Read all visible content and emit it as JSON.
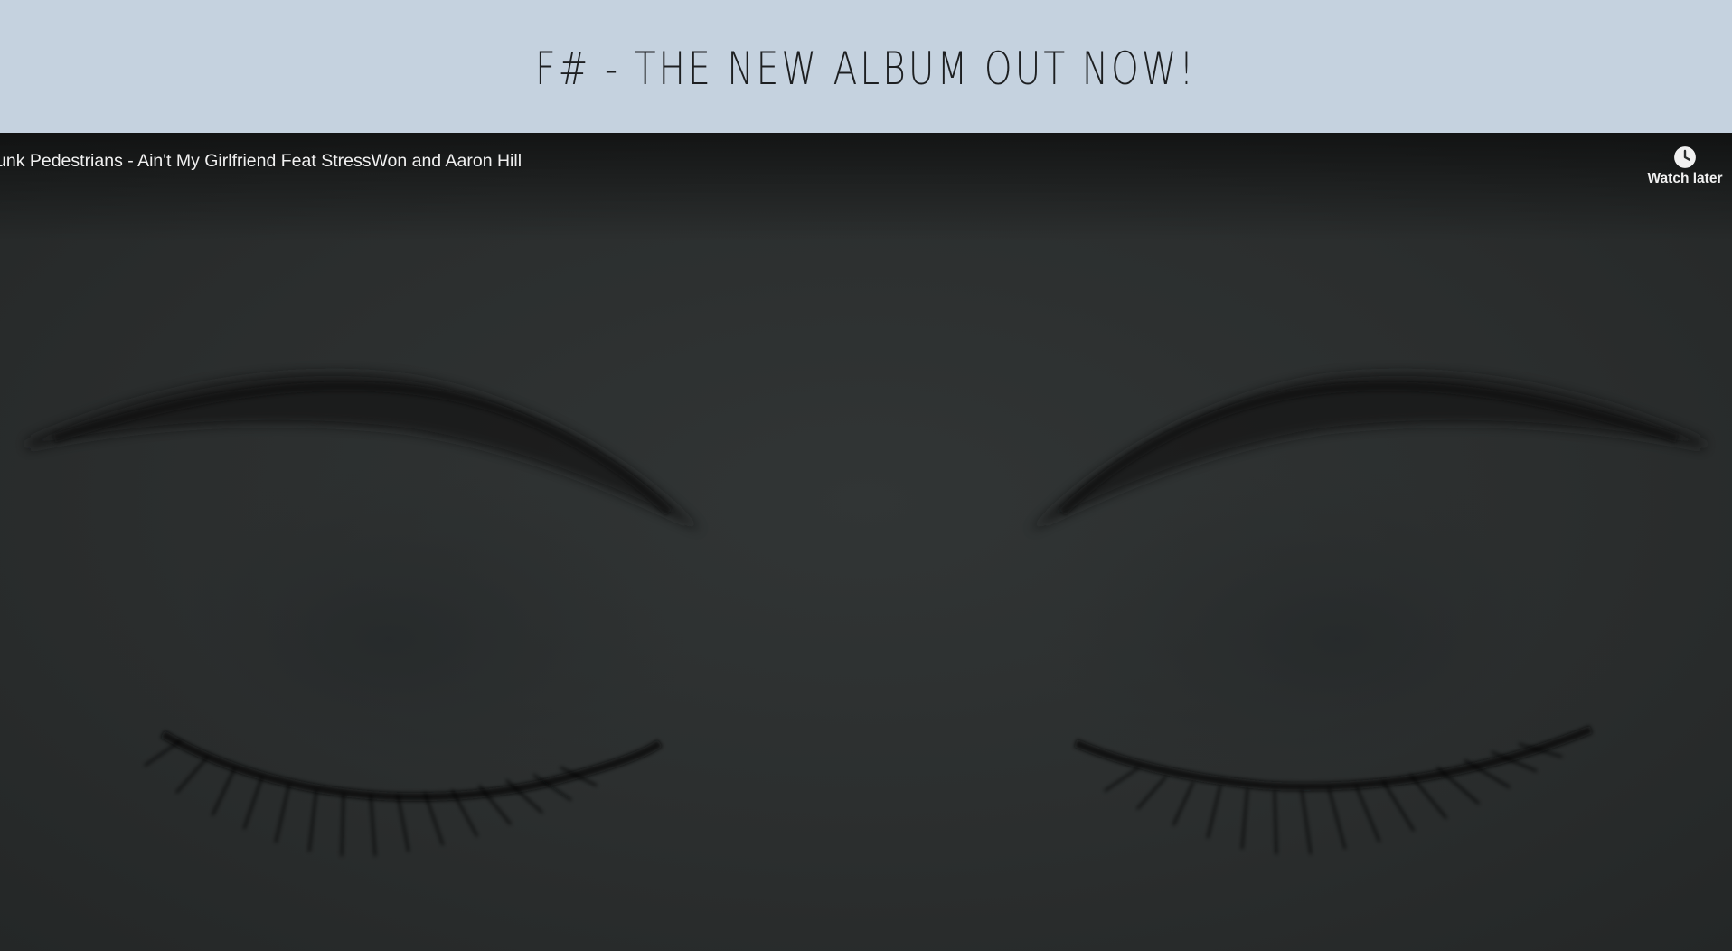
{
  "banner": {
    "title": "F# - THE NEW ALBUM OUT NOW!"
  },
  "video": {
    "title": "unk Pedestrians - Ain't My Girlfriend Feat StressWon and Aaron Hill",
    "watch_later_label": "Watch later",
    "watch_later_icon": "clock-icon",
    "thumbnail_subject": "closed-eyes-artwork"
  },
  "colors": {
    "banner_bg": "#c5d2df",
    "video_bg": "#2b2e2e",
    "text_light": "#f1f1f1"
  }
}
